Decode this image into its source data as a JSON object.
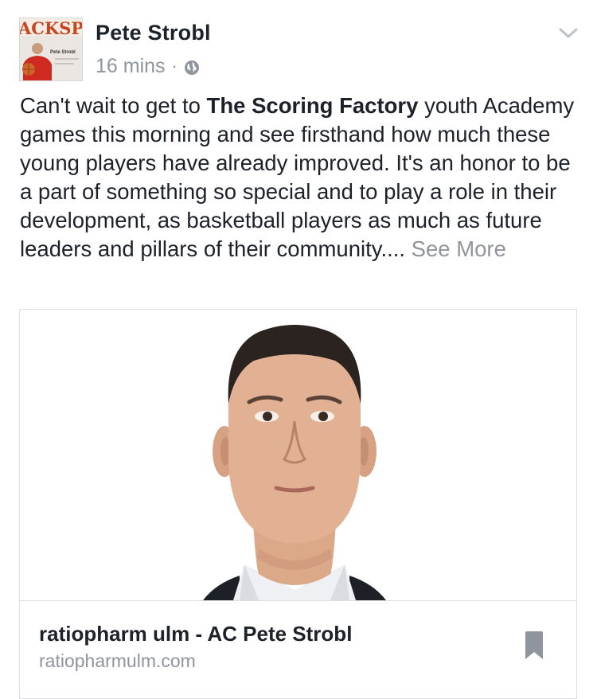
{
  "post": {
    "author": "Pete Strobl",
    "timestamp": "16 mins",
    "separator": "·",
    "privacy_icon": "globe-icon",
    "menu_icon": "chevron-down-icon",
    "avatar": {
      "banner_text": "ACKSPI",
      "caption": "Pete Strobl"
    },
    "text": {
      "intro": "Can't wait to get to ",
      "page_link": "The Scoring Factory",
      "body": " youth Academy games this morning and see firsthand how much these young players have already improved. It's an honor to be a part of something so special and to play a role in their development, as  basketball players as much as future leaders and pillars of their community....",
      "see_more": "See More"
    }
  },
  "link_preview": {
    "title": "ratiopharm ulm - AC Pete Strobl",
    "domain": "ratiopharmulm.com",
    "save_icon": "bookmark-icon"
  },
  "colors": {
    "primary_text": "#1d2129",
    "secondary_text": "#90949c",
    "border": "#dddfe2"
  }
}
